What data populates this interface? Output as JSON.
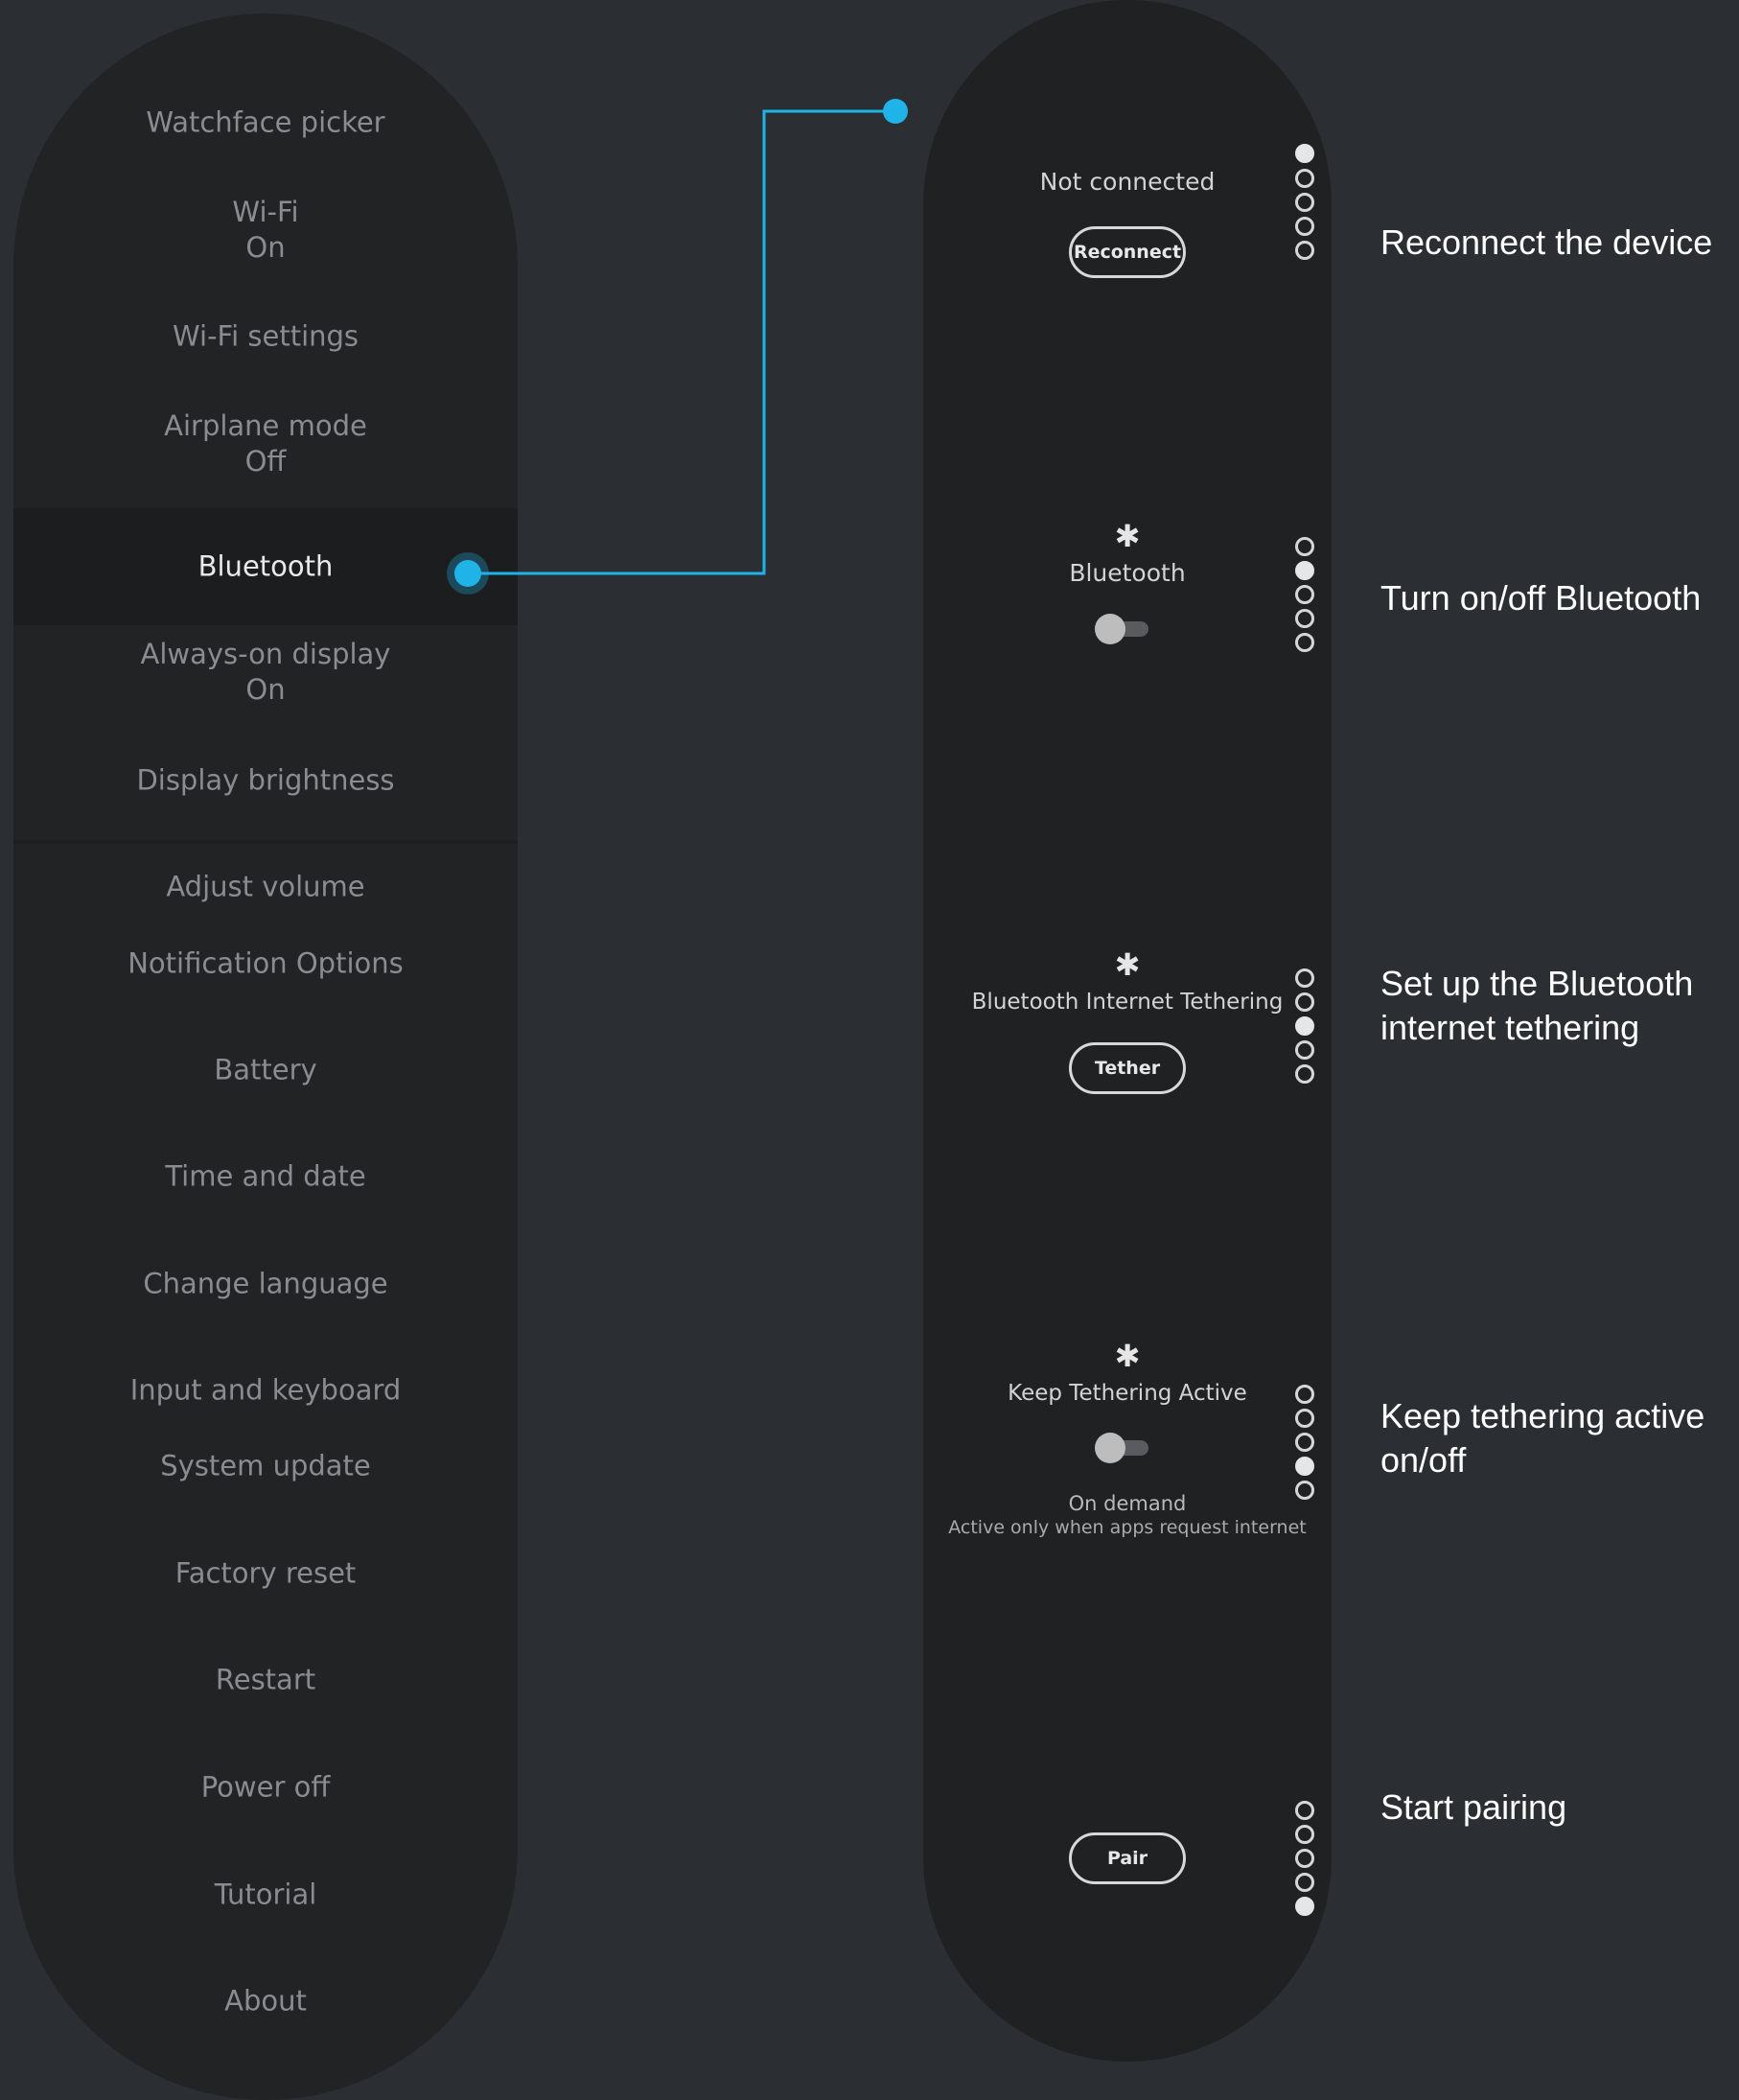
{
  "settings_menu": {
    "items": [
      {
        "label": "Watchface picker",
        "sub": ""
      },
      {
        "label": "Wi-Fi",
        "sub": "On"
      },
      {
        "label": "Wi-Fi settings",
        "sub": ""
      },
      {
        "label": "Airplane mode",
        "sub": "Off"
      },
      {
        "label": "Bluetooth",
        "sub": ""
      },
      {
        "label": "Always-on display",
        "sub": "On"
      },
      {
        "label": "Display brightness",
        "sub": ""
      },
      {
        "label": "Adjust volume",
        "sub": ""
      },
      {
        "label": "Notification Options",
        "sub": ""
      },
      {
        "label": "Battery",
        "sub": ""
      },
      {
        "label": "Time and date",
        "sub": ""
      },
      {
        "label": "Change language",
        "sub": ""
      },
      {
        "label": "Input and keyboard",
        "sub": ""
      },
      {
        "label": "System update",
        "sub": ""
      },
      {
        "label": "Factory reset",
        "sub": ""
      },
      {
        "label": "Restart",
        "sub": ""
      },
      {
        "label": "Power off",
        "sub": ""
      },
      {
        "label": "Tutorial",
        "sub": ""
      },
      {
        "label": "About",
        "sub": ""
      }
    ],
    "selected": "Bluetooth"
  },
  "bluetooth_screens": {
    "reconnect": {
      "status": "Not connected",
      "button": "Reconnect",
      "page": 1
    },
    "bluetooth_toggle": {
      "icon": "bluetooth-icon",
      "glyph": "✱",
      "title": "Bluetooth",
      "state": "off",
      "page": 2
    },
    "tethering": {
      "icon": "bluetooth-icon",
      "glyph": "✱",
      "title": "Bluetooth Internet Tethering",
      "button": "Tether",
      "page": 3
    },
    "keep_active": {
      "icon": "bluetooth-icon",
      "glyph": "✱",
      "title": "Keep Tethering Active",
      "state": "off",
      "mode": "On demand",
      "description": "Active only when apps request internet",
      "page": 4
    },
    "pair": {
      "button": "Pair",
      "page": 5
    },
    "page_count": 5
  },
  "annotations": {
    "reconnect": "Reconnect the device",
    "bluetooth": "Turn on/off Bluetooth",
    "tethering": "Set up the Bluetooth internet tethering",
    "keep_active": "Keep tethering active on/off",
    "pair": "Start pairing"
  },
  "colors": {
    "background": "#2b2e33",
    "panel": "#222325",
    "accent": "#1fb3e8",
    "text": "#8a8c8f"
  }
}
